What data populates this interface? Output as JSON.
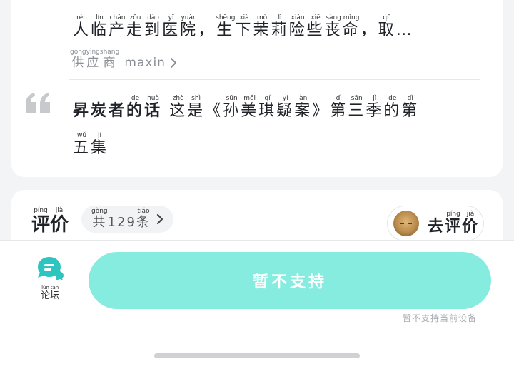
{
  "summary": {
    "tokens": [
      {
        "t": "人",
        "p": "rén"
      },
      {
        "t": "临",
        "p": "lín"
      },
      {
        "t": "产",
        "p": "chǎn"
      },
      {
        "t": "走",
        "p": "zǒu"
      },
      {
        "t": "到",
        "p": "dào"
      },
      {
        "t": "医",
        "p": "yī"
      },
      {
        "t": "院",
        "p": "yuàn"
      },
      {
        "t": "，",
        "p": ""
      },
      {
        "t": "生",
        "p": "shēng"
      },
      {
        "t": "下",
        "p": "xià"
      },
      {
        "t": "茉",
        "p": "mò"
      },
      {
        "t": "莉",
        "p": "lì"
      },
      {
        "t": "险",
        "p": "xiǎn"
      },
      {
        "t": "些",
        "p": "xiē"
      },
      {
        "t": "丧",
        "p": "sàng"
      },
      {
        "t": "命",
        "p": "mìng"
      },
      {
        "t": "，",
        "p": ""
      },
      {
        "t": "取",
        "p": "qǔ"
      },
      {
        "t": "…",
        "p": ""
      }
    ]
  },
  "supplier": {
    "tokens": [
      {
        "t": "供",
        "p": "gōng"
      },
      {
        "t": "应",
        "p": "yìng"
      },
      {
        "t": "商",
        "p": "shāng"
      }
    ],
    "name": "maxin"
  },
  "comment": {
    "line1": [
      {
        "t": "昇",
        "p": ""
      },
      {
        "t": "炭",
        "p": ""
      },
      {
        "t": "者",
        "p": ""
      },
      {
        "t": "的",
        "p": "de"
      },
      {
        "t": "话",
        "p": "huà"
      },
      {
        "t": " ",
        "p": ""
      },
      {
        "t": "这",
        "p": "zhè"
      },
      {
        "t": "是",
        "p": "shì"
      },
      {
        "t": "《",
        "p": ""
      },
      {
        "t": "孙",
        "p": "sūn"
      },
      {
        "t": "美",
        "p": "měi"
      },
      {
        "t": "琪",
        "p": "qí"
      },
      {
        "t": "疑",
        "p": "yí"
      },
      {
        "t": "案",
        "p": "àn"
      },
      {
        "t": "》",
        "p": ""
      },
      {
        "t": "第",
        "p": "dì"
      },
      {
        "t": "三",
        "p": "sān"
      },
      {
        "t": "季",
        "p": "jì"
      },
      {
        "t": "的",
        "p": "de"
      },
      {
        "t": "第",
        "p": "dì"
      }
    ],
    "line2": [
      {
        "t": "五",
        "p": "wǔ"
      },
      {
        "t": "集",
        "p": "jí"
      }
    ],
    "bold_count": 5
  },
  "review": {
    "title": [
      {
        "t": "评",
        "p": "píng"
      },
      {
        "t": "价",
        "p": "jià"
      }
    ],
    "count_tokens": [
      {
        "t": "共",
        "p": "gòng"
      },
      {
        "t": "129",
        "p": ""
      },
      {
        "t": "条",
        "p": "tiáo"
      }
    ],
    "go_review": [
      {
        "t": "去",
        "p": ""
      },
      {
        "t": "评",
        "p": "píng"
      },
      {
        "t": "价",
        "p": "jià"
      }
    ]
  },
  "bottom": {
    "forum_tokens": [
      {
        "t": "论",
        "p": "lùn"
      },
      {
        "t": "坛",
        "p": "tán"
      }
    ],
    "support_label": "暂不支持",
    "device_note": "暂不支持当前设备"
  },
  "colors": {
    "accent": "#86ece0",
    "forum_icon": "#2ec4c0",
    "quote": "#c7c9cc"
  },
  "icons": {
    "quote": "quote-icon",
    "chevron": "chevron-right-icon",
    "forum": "chat-bubble-icon",
    "avatar": "avatar"
  }
}
